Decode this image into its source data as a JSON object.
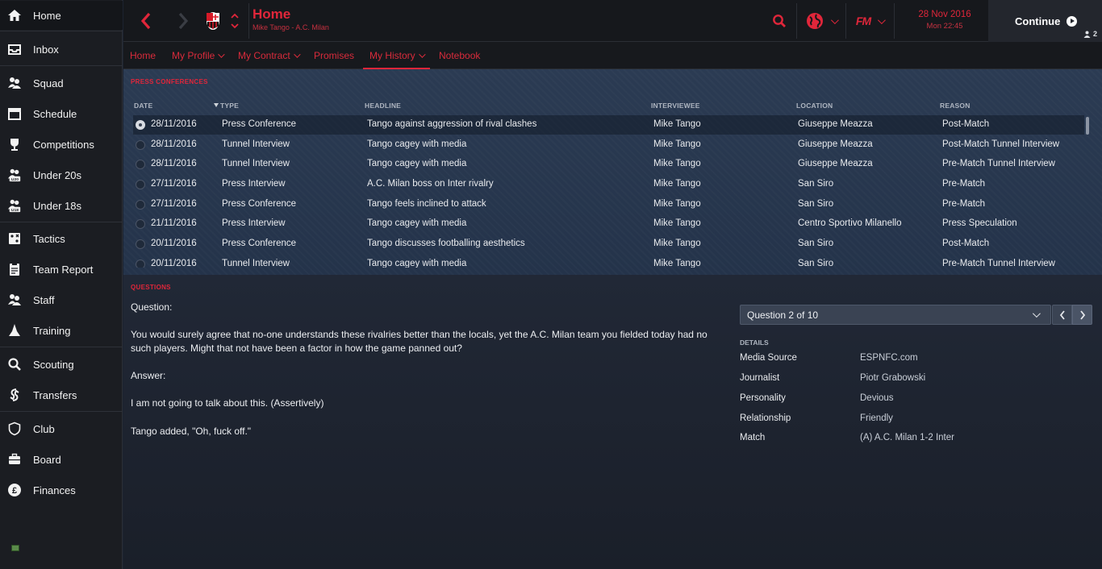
{
  "sidebar": {
    "items": [
      {
        "label": "Home",
        "icon": "home-icon"
      },
      {
        "label": "Inbox",
        "icon": "inbox-icon"
      },
      {
        "label": "Squad",
        "icon": "squad-icon"
      },
      {
        "label": "Schedule",
        "icon": "calendar-icon"
      },
      {
        "label": "Competitions",
        "icon": "trophy-icon"
      },
      {
        "label": "Under 20s",
        "icon": "under20-icon",
        "badge": "U20"
      },
      {
        "label": "Under 18s",
        "icon": "under18-icon",
        "badge": "U18"
      },
      {
        "label": "Tactics",
        "icon": "tactics-icon"
      },
      {
        "label": "Team Report",
        "icon": "report-icon"
      },
      {
        "label": "Staff",
        "icon": "staff-icon"
      },
      {
        "label": "Training",
        "icon": "training-icon"
      },
      {
        "label": "Scouting",
        "icon": "search-icon"
      },
      {
        "label": "Transfers",
        "icon": "transfers-icon"
      },
      {
        "label": "Club",
        "icon": "shield-icon"
      },
      {
        "label": "Board",
        "icon": "briefcase-icon"
      },
      {
        "label": "Finances",
        "icon": "pound-icon"
      }
    ]
  },
  "header": {
    "title": "Home",
    "subtitle": "Mike Tango - A.C. Milan",
    "date": "28 Nov 2016",
    "time": "Mon 22:45",
    "continue_label": "Continue",
    "notification_count": "2",
    "fm_logo": "FM"
  },
  "tabs": [
    {
      "label": "Home",
      "dropdown": false
    },
    {
      "label": "My Profile",
      "dropdown": true
    },
    {
      "label": "My Contract",
      "dropdown": true
    },
    {
      "label": "Promises",
      "dropdown": false
    },
    {
      "label": "My History",
      "dropdown": true,
      "active": true
    },
    {
      "label": "Notebook",
      "dropdown": false
    }
  ],
  "press": {
    "section_title": "PRESS CONFERENCES",
    "columns": {
      "date": "DATE",
      "type": "TYPE",
      "headline": "HEADLINE",
      "interviewee": "INTERVIEWEE",
      "location": "LOCATION",
      "reason": "REASON"
    },
    "rows": [
      {
        "date": "28/11/2016",
        "type": "Press Conference",
        "headline": "Tango against aggression of rival clashes",
        "interviewee": "Mike Tango",
        "location": "Giuseppe Meazza",
        "reason": "Post-Match"
      },
      {
        "date": "28/11/2016",
        "type": "Tunnel Interview",
        "headline": "Tango cagey with media",
        "interviewee": "Mike Tango",
        "location": "Giuseppe Meazza",
        "reason": "Post-Match Tunnel Interview"
      },
      {
        "date": "28/11/2016",
        "type": "Tunnel Interview",
        "headline": "Tango cagey with media",
        "interviewee": "Mike Tango",
        "location": "Giuseppe Meazza",
        "reason": "Pre-Match Tunnel Interview"
      },
      {
        "date": "27/11/2016",
        "type": "Press Interview",
        "headline": "A.C. Milan boss on Inter rivalry",
        "interviewee": "Mike Tango",
        "location": "San Siro",
        "reason": "Pre-Match"
      },
      {
        "date": "27/11/2016",
        "type": "Press Conference",
        "headline": "Tango feels inclined to attack",
        "interviewee": "Mike Tango",
        "location": "San Siro",
        "reason": "Pre-Match"
      },
      {
        "date": "21/11/2016",
        "type": "Press Interview",
        "headline": "Tango cagey with media",
        "interviewee": "Mike Tango",
        "location": "Centro Sportivo Milanello",
        "reason": "Press Speculation"
      },
      {
        "date": "20/11/2016",
        "type": "Press Conference",
        "headline": "Tango discusses footballing aesthetics",
        "interviewee": "Mike Tango",
        "location": "San Siro",
        "reason": "Post-Match"
      },
      {
        "date": "20/11/2016",
        "type": "Tunnel Interview",
        "headline": "Tango cagey with media",
        "interviewee": "Mike Tango",
        "location": "San Siro",
        "reason": "Pre-Match Tunnel Interview"
      }
    ]
  },
  "questions": {
    "section_title": "QUESTIONS",
    "question_label": "Question:",
    "question_text": "You would surely agree that no-one understands these rivalries better than the locals, yet the A.C. Milan team you fielded today had no such players. Might that not have been a factor in how the game panned out?",
    "answer_label": "Answer:",
    "answer_text": "I am not going to talk about this. (Assertively)",
    "added_text": "Tango added, \"Oh, fuck off.\"",
    "selector_value": "Question 2 of 10",
    "details_title": "DETAILS",
    "details": [
      {
        "key": "Media Source",
        "value": "ESPNFC.com"
      },
      {
        "key": "Journalist",
        "value": "Piotr Grabowski"
      },
      {
        "key": "Personality",
        "value": "Devious"
      },
      {
        "key": "Relationship",
        "value": "Friendly"
      },
      {
        "key": "Match",
        "value": "(A) A.C. Milan 1-2 Inter"
      }
    ]
  },
  "colors": {
    "accent": "#e0263a",
    "sidebar_bg": "#1b1d22",
    "panel_bg": "#273650"
  }
}
